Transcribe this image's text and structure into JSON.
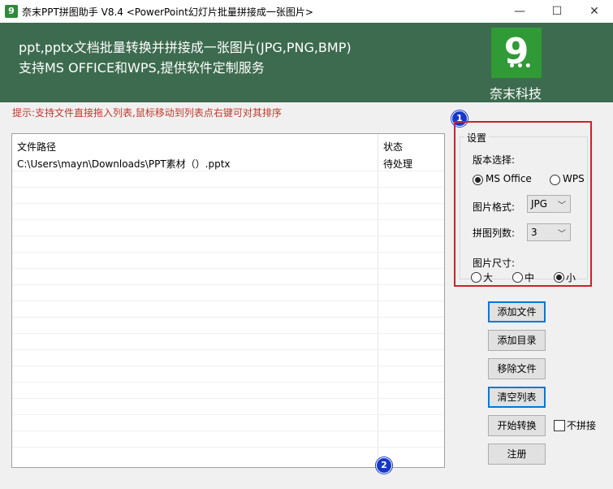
{
  "window": {
    "title": "奈末PPT拼图助手 V8.4 <PowerPoint幻灯片批量拼接成一张图片>",
    "app_icon_glyph": "9",
    "controls": {
      "minimize": "—",
      "maximize": "☐",
      "close": "✕"
    }
  },
  "header": {
    "line1": "ppt,pptx文档批量转换并拼接成一张图片(JPG,PNG,BMP)",
    "line2": "支持MS OFFICE和WPS,提供软件定制服务",
    "logo_digit": "9",
    "logo_dots": "•••",
    "brand": "奈末科技",
    "colors": {
      "header_bg": "#3d6b4f",
      "logo_bg": "#2f9a36"
    }
  },
  "hint": "提示:支持文件直接拖入列表,鼠标移动到列表点右键可对其排序",
  "file_list": {
    "columns": [
      "文件路径",
      "状态"
    ],
    "rows": [
      {
        "path": "C:\\Users\\mayn\\Downloads\\PPT素材（）.pptx",
        "status": "待处理"
      }
    ]
  },
  "annotations": {
    "marker1": "1",
    "marker2": "2",
    "highlight_color": "#d0202a",
    "marker_color": "#1538c9"
  },
  "settings": {
    "group_title": "设置",
    "version_label": "版本选择:",
    "version_options": [
      "MS Office",
      "WPS"
    ],
    "version_selected": "MS Office",
    "format_label": "图片格式:",
    "format_value": "JPG",
    "columns_label": "拼图列数:",
    "columns_value": "3",
    "size_label": "图片尺寸:",
    "size_options": [
      "大",
      "中",
      "小"
    ],
    "size_selected": "小"
  },
  "buttons": {
    "add_file": "添加文件",
    "add_dir": "添加目录",
    "remove_file": "移除文件",
    "clear_list": "清空列表",
    "start_convert": "开始转换",
    "register": "注册"
  },
  "no_stitch_label": "不拼接",
  "no_stitch_checked": false
}
